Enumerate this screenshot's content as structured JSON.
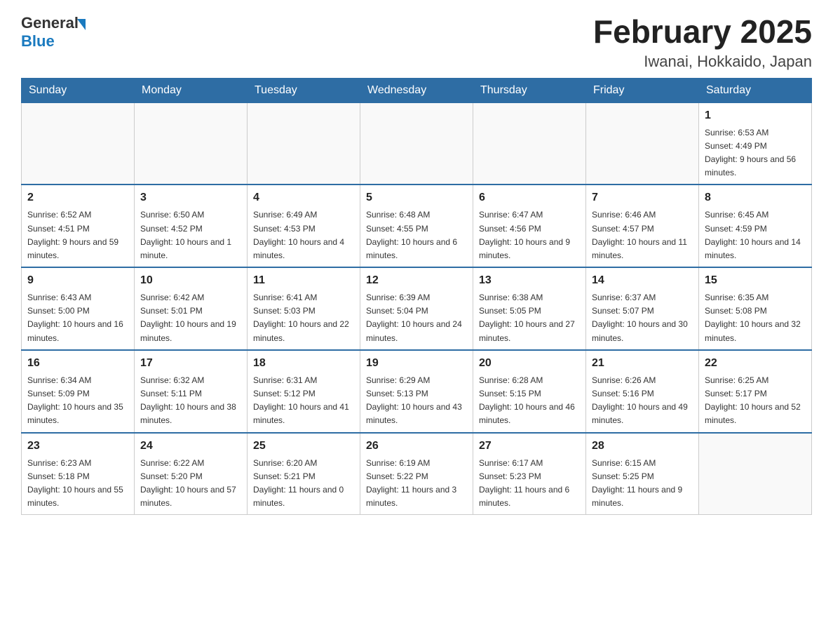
{
  "header": {
    "logo": {
      "general": "General",
      "blue": "Blue",
      "aria": "GeneralBlue logo"
    },
    "title": "February 2025",
    "subtitle": "Iwanai, Hokkaido, Japan"
  },
  "weekdays": [
    "Sunday",
    "Monday",
    "Tuesday",
    "Wednesday",
    "Thursday",
    "Friday",
    "Saturday"
  ],
  "weeks": [
    [
      {
        "day": "",
        "info": ""
      },
      {
        "day": "",
        "info": ""
      },
      {
        "day": "",
        "info": ""
      },
      {
        "day": "",
        "info": ""
      },
      {
        "day": "",
        "info": ""
      },
      {
        "day": "",
        "info": ""
      },
      {
        "day": "1",
        "info": "Sunrise: 6:53 AM\nSunset: 4:49 PM\nDaylight: 9 hours and 56 minutes."
      }
    ],
    [
      {
        "day": "2",
        "info": "Sunrise: 6:52 AM\nSunset: 4:51 PM\nDaylight: 9 hours and 59 minutes."
      },
      {
        "day": "3",
        "info": "Sunrise: 6:50 AM\nSunset: 4:52 PM\nDaylight: 10 hours and 1 minute."
      },
      {
        "day": "4",
        "info": "Sunrise: 6:49 AM\nSunset: 4:53 PM\nDaylight: 10 hours and 4 minutes."
      },
      {
        "day": "5",
        "info": "Sunrise: 6:48 AM\nSunset: 4:55 PM\nDaylight: 10 hours and 6 minutes."
      },
      {
        "day": "6",
        "info": "Sunrise: 6:47 AM\nSunset: 4:56 PM\nDaylight: 10 hours and 9 minutes."
      },
      {
        "day": "7",
        "info": "Sunrise: 6:46 AM\nSunset: 4:57 PM\nDaylight: 10 hours and 11 minutes."
      },
      {
        "day": "8",
        "info": "Sunrise: 6:45 AM\nSunset: 4:59 PM\nDaylight: 10 hours and 14 minutes."
      }
    ],
    [
      {
        "day": "9",
        "info": "Sunrise: 6:43 AM\nSunset: 5:00 PM\nDaylight: 10 hours and 16 minutes."
      },
      {
        "day": "10",
        "info": "Sunrise: 6:42 AM\nSunset: 5:01 PM\nDaylight: 10 hours and 19 minutes."
      },
      {
        "day": "11",
        "info": "Sunrise: 6:41 AM\nSunset: 5:03 PM\nDaylight: 10 hours and 22 minutes."
      },
      {
        "day": "12",
        "info": "Sunrise: 6:39 AM\nSunset: 5:04 PM\nDaylight: 10 hours and 24 minutes."
      },
      {
        "day": "13",
        "info": "Sunrise: 6:38 AM\nSunset: 5:05 PM\nDaylight: 10 hours and 27 minutes."
      },
      {
        "day": "14",
        "info": "Sunrise: 6:37 AM\nSunset: 5:07 PM\nDaylight: 10 hours and 30 minutes."
      },
      {
        "day": "15",
        "info": "Sunrise: 6:35 AM\nSunset: 5:08 PM\nDaylight: 10 hours and 32 minutes."
      }
    ],
    [
      {
        "day": "16",
        "info": "Sunrise: 6:34 AM\nSunset: 5:09 PM\nDaylight: 10 hours and 35 minutes."
      },
      {
        "day": "17",
        "info": "Sunrise: 6:32 AM\nSunset: 5:11 PM\nDaylight: 10 hours and 38 minutes."
      },
      {
        "day": "18",
        "info": "Sunrise: 6:31 AM\nSunset: 5:12 PM\nDaylight: 10 hours and 41 minutes."
      },
      {
        "day": "19",
        "info": "Sunrise: 6:29 AM\nSunset: 5:13 PM\nDaylight: 10 hours and 43 minutes."
      },
      {
        "day": "20",
        "info": "Sunrise: 6:28 AM\nSunset: 5:15 PM\nDaylight: 10 hours and 46 minutes."
      },
      {
        "day": "21",
        "info": "Sunrise: 6:26 AM\nSunset: 5:16 PM\nDaylight: 10 hours and 49 minutes."
      },
      {
        "day": "22",
        "info": "Sunrise: 6:25 AM\nSunset: 5:17 PM\nDaylight: 10 hours and 52 minutes."
      }
    ],
    [
      {
        "day": "23",
        "info": "Sunrise: 6:23 AM\nSunset: 5:18 PM\nDaylight: 10 hours and 55 minutes."
      },
      {
        "day": "24",
        "info": "Sunrise: 6:22 AM\nSunset: 5:20 PM\nDaylight: 10 hours and 57 minutes."
      },
      {
        "day": "25",
        "info": "Sunrise: 6:20 AM\nSunset: 5:21 PM\nDaylight: 11 hours and 0 minutes."
      },
      {
        "day": "26",
        "info": "Sunrise: 6:19 AM\nSunset: 5:22 PM\nDaylight: 11 hours and 3 minutes."
      },
      {
        "day": "27",
        "info": "Sunrise: 6:17 AM\nSunset: 5:23 PM\nDaylight: 11 hours and 6 minutes."
      },
      {
        "day": "28",
        "info": "Sunrise: 6:15 AM\nSunset: 5:25 PM\nDaylight: 11 hours and 9 minutes."
      },
      {
        "day": "",
        "info": ""
      }
    ]
  ]
}
